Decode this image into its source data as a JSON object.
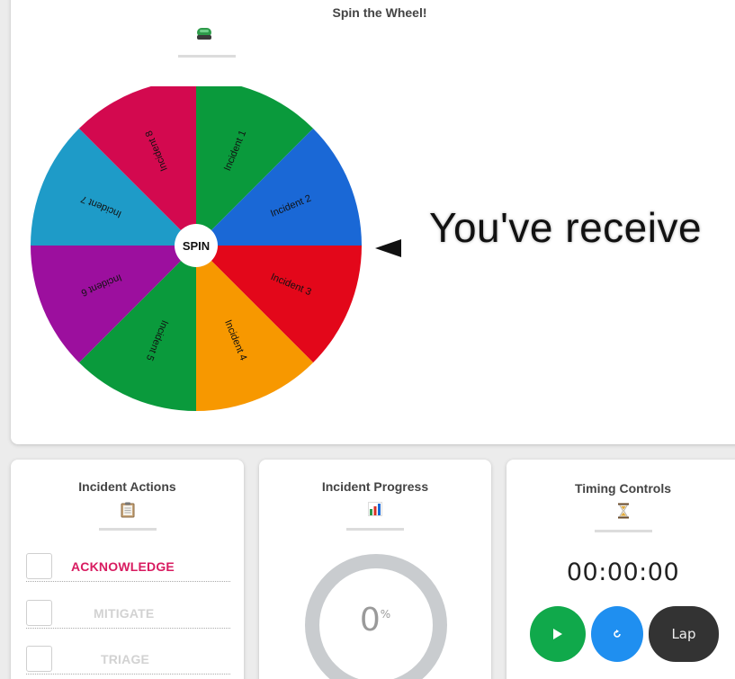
{
  "wheel_panel": {
    "title": "Spin the Wheel!",
    "icon": "computer-disk-icon",
    "spin_label": "SPIN",
    "result_text": "You've receive",
    "segments": [
      {
        "label": "Incident 1",
        "color": "#0a9a3c"
      },
      {
        "label": "Incident 2",
        "color": "#1a68d6"
      },
      {
        "label": "Incident 3",
        "color": "#e3071a"
      },
      {
        "label": "Incident 4",
        "color": "#f79800"
      },
      {
        "label": "Incident 5",
        "color": "#0a9a3c"
      },
      {
        "label": "Incident 6",
        "color": "#9c0f9e"
      },
      {
        "label": "Incident 7",
        "color": "#1e9bc8"
      },
      {
        "label": "Incident 8",
        "color": "#d3094f"
      }
    ]
  },
  "actions_panel": {
    "title": "Incident Actions",
    "icon": "clipboard-icon",
    "items": [
      {
        "label": "ACKNOWLEDGE",
        "checked": false
      },
      {
        "label": "MITIGATE",
        "checked": false
      },
      {
        "label": "TRIAGE",
        "checked": false
      }
    ]
  },
  "progress_panel": {
    "title": "Incident Progress",
    "icon": "bar-chart-icon",
    "value": "0",
    "unit": "%"
  },
  "timing_panel": {
    "title": "Timing Controls",
    "icon": "hourglass-icon",
    "time": "00:00:00",
    "play_icon": "play-icon",
    "reset_icon": "reset-icon",
    "lap_label": "Lap"
  },
  "colors": {
    "accent_pink": "#d81b60",
    "play_green": "#10a94b",
    "reset_blue": "#1f8ff0",
    "lap_dark": "#333333",
    "ring_gray": "#c9cccf"
  }
}
